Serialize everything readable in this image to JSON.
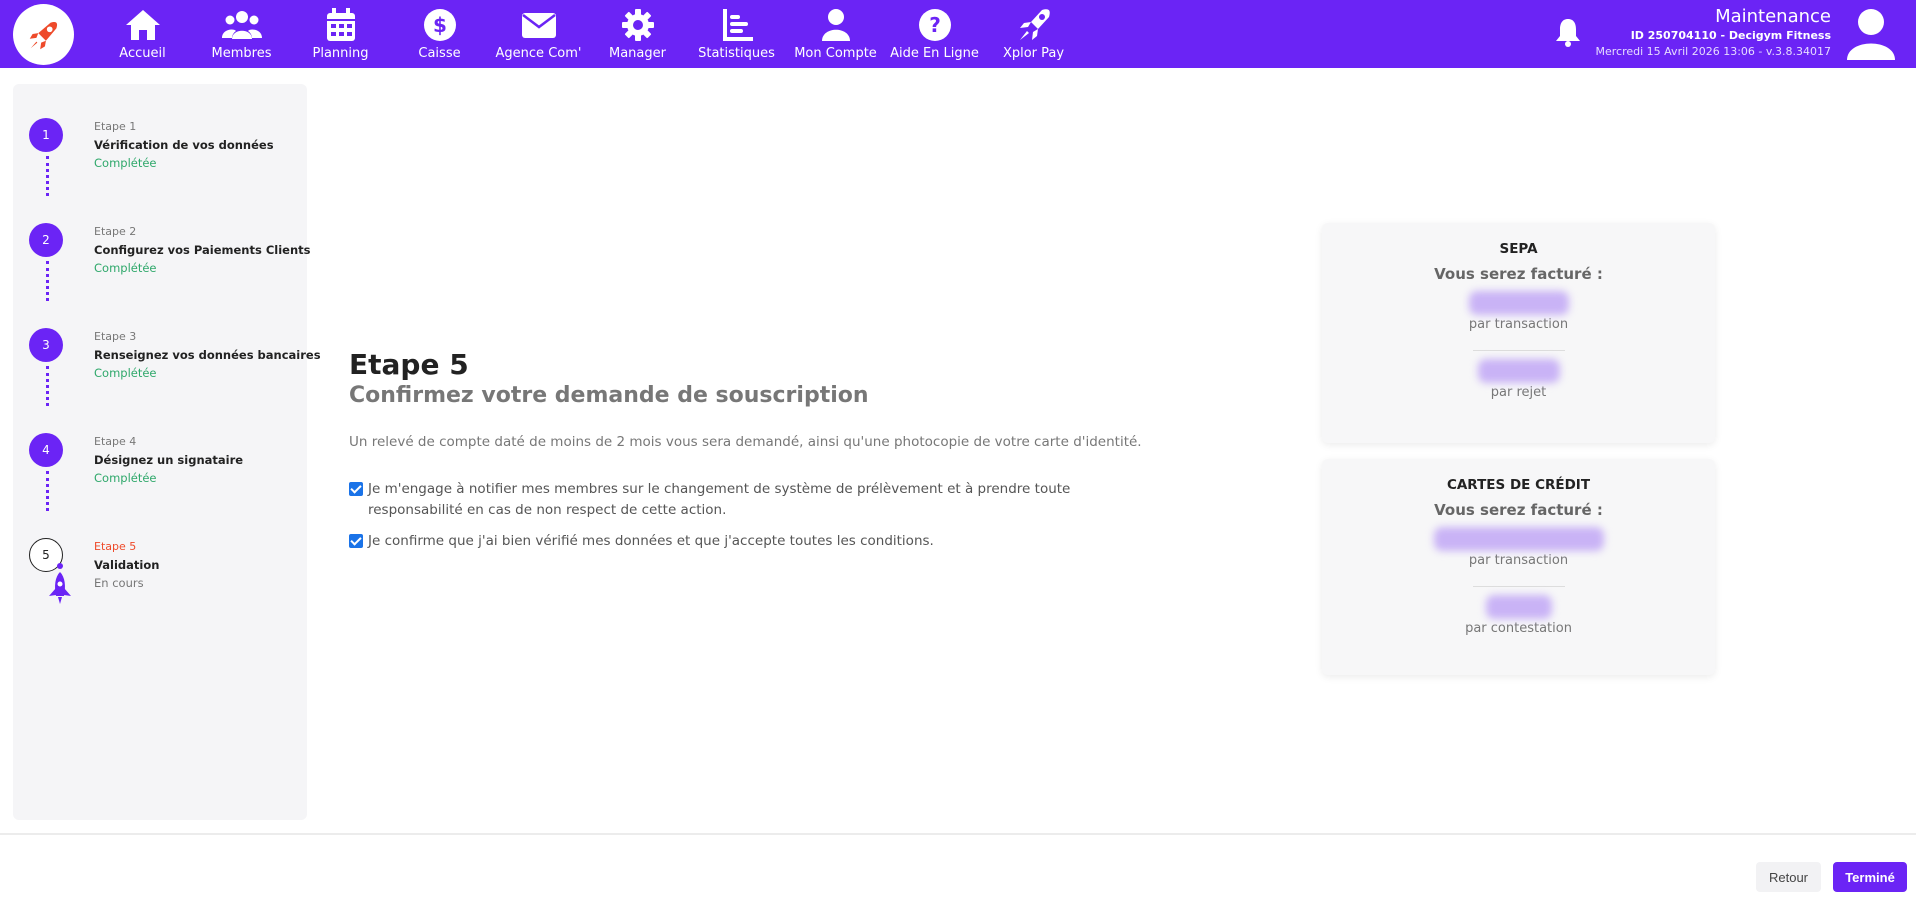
{
  "colors": {
    "brand": "#6b24f5",
    "accent": "#ee4a2a",
    "success": "#2fa86b"
  },
  "nav": [
    {
      "label": "Accueil",
      "icon": "home-icon"
    },
    {
      "label": "Membres",
      "icon": "users-icon"
    },
    {
      "label": "Planning",
      "icon": "calendar-icon"
    },
    {
      "label": "Caisse",
      "icon": "dollar-icon"
    },
    {
      "label": "Agence Com'",
      "icon": "envelope-icon"
    },
    {
      "label": "Manager",
      "icon": "gear-icon"
    },
    {
      "label": "Statistiques",
      "icon": "chart-icon"
    },
    {
      "label": "Mon Compte",
      "icon": "user-icon"
    },
    {
      "label": "Aide En Ligne",
      "icon": "help-icon"
    },
    {
      "label": "Xplor Pay",
      "icon": "rocket-icon"
    }
  ],
  "header": {
    "user_name": "Maintenance",
    "user_id": "ID 250704110 - Decigym Fitness",
    "date_version": "Mercredi 15 Avril 2026 13:06 - v.3.8.34017"
  },
  "steps": [
    {
      "num": "1",
      "label": "Etape 1",
      "title": "Vérification de vos données",
      "status": "Complétée"
    },
    {
      "num": "2",
      "label": "Etape 2",
      "title": "Configurez vos Paiements Clients",
      "status": "Complétée"
    },
    {
      "num": "3",
      "label": "Etape 3",
      "title": "Renseignez vos données bancaires",
      "status": "Complétée"
    },
    {
      "num": "4",
      "label": "Etape 4",
      "title": "Désignez un signataire",
      "status": "Complétée"
    },
    {
      "num": "5",
      "label": "Etape 5",
      "title": "Validation",
      "status": "En cours"
    }
  ],
  "main": {
    "title": "Etape 5",
    "subtitle": "Confirmez votre demande de souscription",
    "description": "Un relevé de compte daté de moins de 2 mois vous sera demandé, ainsi qu'une photocopie de votre carte d'identité.",
    "check1": "Je m'engage à notifier mes membres sur le changement de système de prélèvement et à prendre toute responsabilité en cas de non respect de cette action.",
    "check2": "Je confirme que j'ai bien vérifié mes données et que j'accepte toutes les conditions."
  },
  "sepa": {
    "title": "SEPA",
    "subtitle": "Vous serez facturé :",
    "unit1": "par transaction",
    "unit2": "par rejet"
  },
  "cards": {
    "title": "CARTES DE CRÉDIT",
    "subtitle": "Vous serez facturé :",
    "unit1": "par transaction",
    "unit2": "par contestation"
  },
  "footer": {
    "back": "Retour",
    "done": "Terminé"
  }
}
